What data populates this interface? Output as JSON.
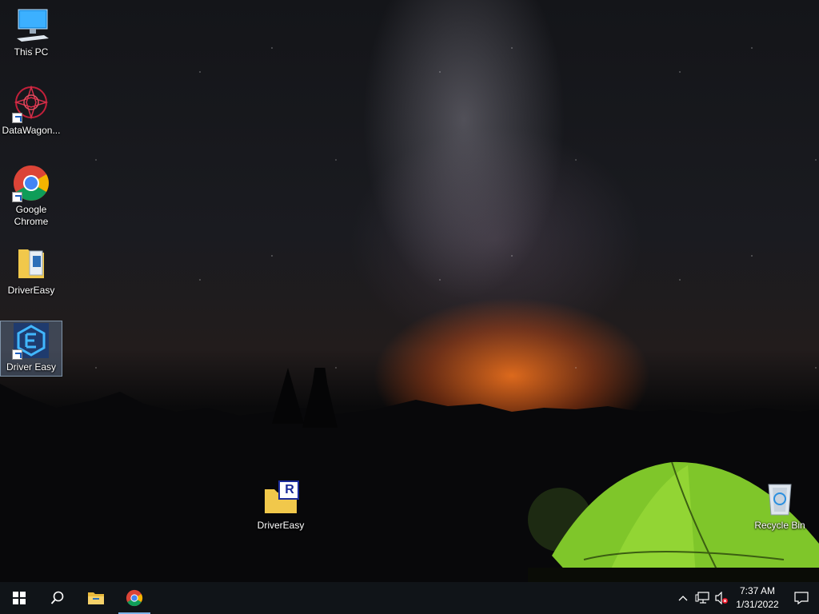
{
  "desktop": {
    "icons": [
      {
        "label": "This PC"
      },
      {
        "label": "DataWagon..."
      },
      {
        "label": "Google Chrome"
      },
      {
        "label": "DriverEasy"
      },
      {
        "label": "Driver Easy"
      },
      {
        "label": "DriverEasy"
      },
      {
        "label": "Recycle Bin"
      }
    ],
    "installer_badge": "R"
  },
  "taskbar": {
    "time": "7:37 AM",
    "date": "1/31/2022"
  },
  "colors": {
    "taskbar_bg": "#101418",
    "accent": "#7cb3e8"
  }
}
